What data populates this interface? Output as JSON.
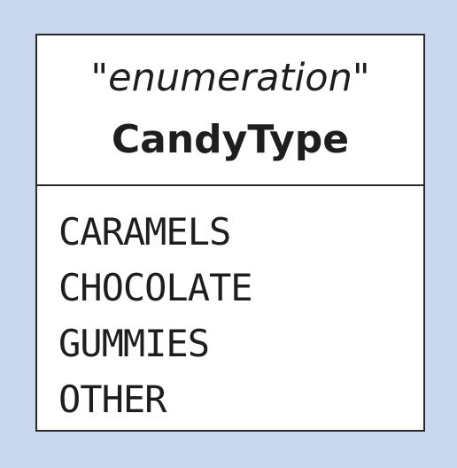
{
  "enumeration": {
    "stereotype": "\"enumeration\"",
    "name": "CandyType",
    "literals": [
      "CARAMELS",
      "CHOCOLATE",
      "GUMMIES",
      "OTHER"
    ]
  },
  "colors": {
    "background": "#c9d7ef",
    "box_fill": "#ffffff",
    "border": "#2a2a2a",
    "text": "#1e1e1e"
  }
}
